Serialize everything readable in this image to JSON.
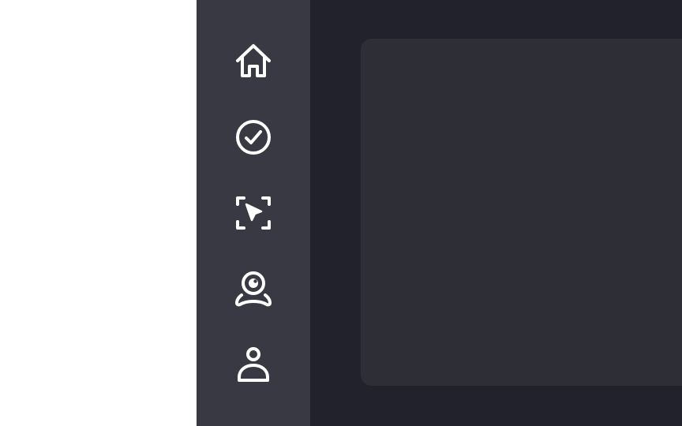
{
  "colors": {
    "sidebar_bg": "#393943",
    "main_bg": "#22222c",
    "panel_bg": "#2e2e37",
    "icon": "#ffffff"
  },
  "sidebar": {
    "items": [
      {
        "id": "home",
        "icon": "home-icon"
      },
      {
        "id": "tasks",
        "icon": "check-circle-icon"
      },
      {
        "id": "select",
        "icon": "cursor-select-icon"
      },
      {
        "id": "webcam",
        "icon": "webcam-icon"
      },
      {
        "id": "profile",
        "icon": "user-icon"
      }
    ]
  }
}
